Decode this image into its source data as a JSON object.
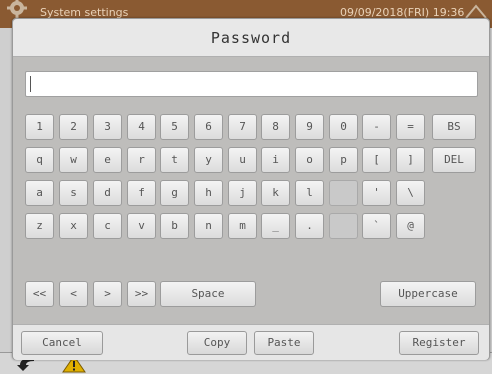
{
  "background": {
    "app_title": "System settings",
    "datetime": "09/09/2018(FRI) 19:36"
  },
  "dialog": {
    "title": "Password",
    "password_value": ""
  },
  "keyboard": {
    "row1": [
      "1",
      "2",
      "3",
      "4",
      "5",
      "6",
      "7",
      "8",
      "9",
      "0",
      "-",
      "="
    ],
    "row2": [
      "q",
      "w",
      "e",
      "r",
      "t",
      "y",
      "u",
      "i",
      "o",
      "p",
      "[",
      "]"
    ],
    "row3": [
      "a",
      "s",
      "d",
      "f",
      "g",
      "h",
      "j",
      "k",
      "l",
      "",
      "'",
      "\\"
    ],
    "row4": [
      "z",
      "x",
      "c",
      "v",
      "b",
      "n",
      "m",
      "_",
      ".",
      "",
      "`",
      "@"
    ],
    "bs_label": "BS",
    "del_label": "DEL",
    "nav": [
      "<<",
      "<",
      ">",
      ">>"
    ],
    "space_label": "Space",
    "case_label": "Uppercase"
  },
  "footer": {
    "cancel_label": "Cancel",
    "copy_label": "Copy",
    "paste_label": "Paste",
    "register_label": "Register"
  },
  "colors": {
    "appbar": "#8a5a32",
    "dialog_bg": "#bebdbb",
    "title_bg": "#e8e8e8",
    "warning_icon": "#e0b000"
  }
}
